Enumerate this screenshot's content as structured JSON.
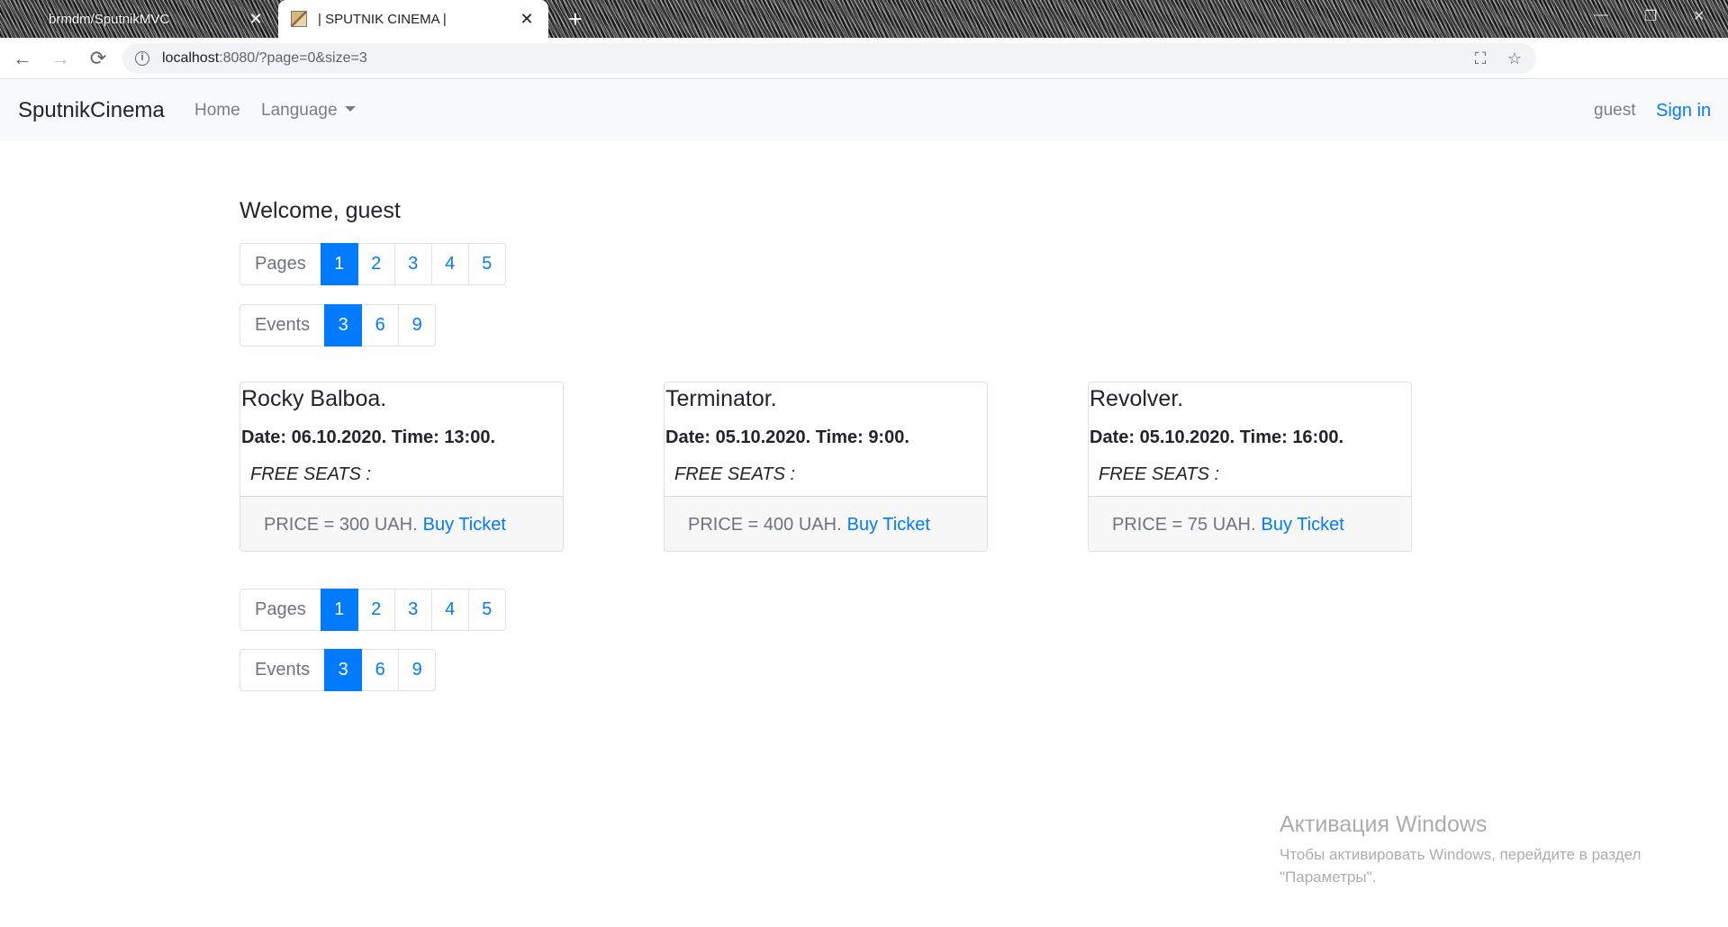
{
  "browser": {
    "tabs": [
      {
        "title": "brmdm/SputnikMVC",
        "active": false
      },
      {
        "title": "| SPUTNIK CINEMA |",
        "active": true
      }
    ],
    "url_host": "localhost",
    "url_rest": ":8080/?page=0&size=3"
  },
  "navbar": {
    "brand": "SputnikCinema",
    "home": "Home",
    "language": "Language",
    "user": "guest",
    "signin": "Sign in"
  },
  "main": {
    "welcome": "Welcome, guest",
    "pages_label": "Pages",
    "pages": [
      "1",
      "2",
      "3",
      "4",
      "5"
    ],
    "active_page": "1",
    "events_label": "Events",
    "events": [
      "3",
      "6",
      "9"
    ],
    "active_events": "3"
  },
  "events": [
    {
      "title": "Rocky Balboa.",
      "datetime": "Date: 06.10.2020. Time: 13:00.",
      "seats": "FREE SEATS :",
      "price": "PRICE = 300 UAH.",
      "buy": "Buy Ticket"
    },
    {
      "title": "Terminator.",
      "datetime": "Date: 05.10.2020. Time: 9:00.",
      "seats": "FREE SEATS :",
      "price": "PRICE = 400 UAH.",
      "buy": "Buy Ticket"
    },
    {
      "title": "Revolver.",
      "datetime": "Date: 05.10.2020. Time: 16:00.",
      "seats": "FREE SEATS :",
      "price": "PRICE = 75 UAH.",
      "buy": "Buy Ticket"
    }
  ],
  "watermark": {
    "title": "Активация Windows",
    "line1": "Чтобы активировать Windows, перейдите в раздел",
    "line2": "\"Параметры\"."
  }
}
